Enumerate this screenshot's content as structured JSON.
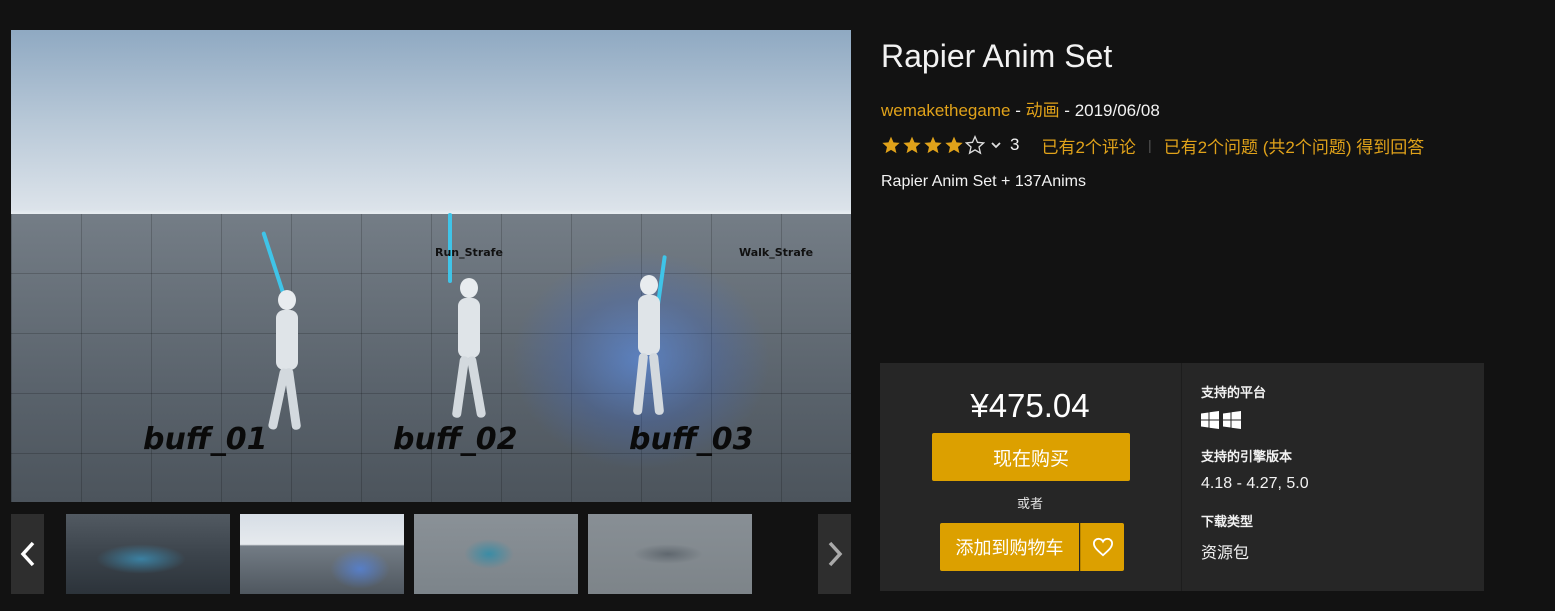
{
  "product": {
    "title": "Rapier Anim Set",
    "seller": "wemakethegame",
    "category": "动画",
    "date": "2019/06/08",
    "meta_sep": " - ",
    "rating_stars": 4,
    "rating_count": "3",
    "reviews_link": "已有2个评论",
    "questions_link": "已有2个问题 (共2个问题) 得到回答",
    "summary": "Rapier Anim Set + 137Anims"
  },
  "hero": {
    "labels": [
      "buff_01",
      "buff_02",
      "buff_03"
    ],
    "small_labels": [
      "Run_Strafe",
      "Walk_Strafe"
    ]
  },
  "purchase": {
    "price": "¥475.04",
    "buy_now": "现在购买",
    "or": "或者",
    "add_to_cart": "添加到购物车"
  },
  "specs": {
    "platforms_heading": "支持的平台",
    "platform_icons": [
      "windows-icon",
      "windows-icon"
    ],
    "engine_heading": "支持的引擎版本",
    "engine_versions": "4.18 - 4.27, 5.0",
    "download_heading": "下载类型",
    "download_type": "资源包"
  },
  "colors": {
    "accent": "#dca000",
    "link": "#e0a21a",
    "panel": "#262626",
    "background": "#121212"
  }
}
